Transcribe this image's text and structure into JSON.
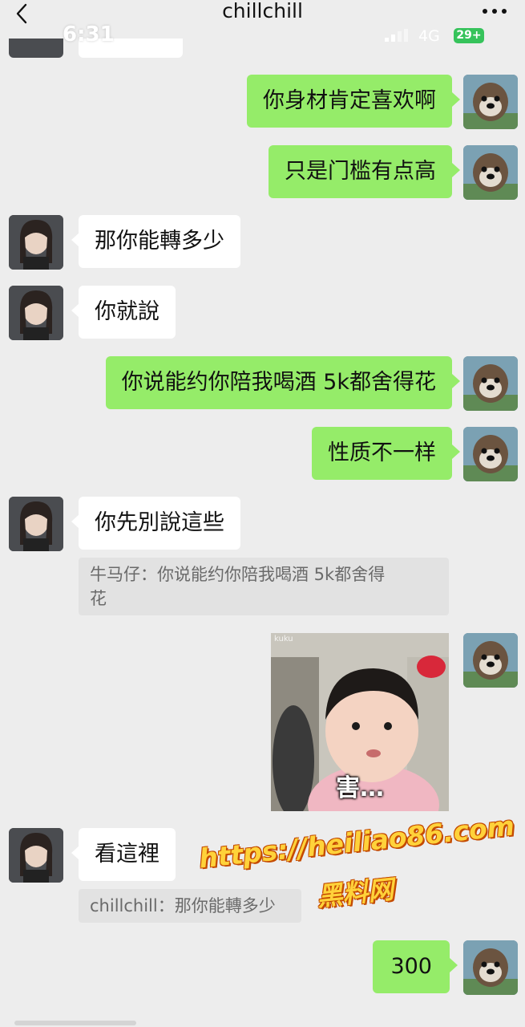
{
  "header": {
    "title": "chillchill",
    "back_icon": "chevron-left-icon",
    "more_icon": "more-dots-icon"
  },
  "status_bar": {
    "time": "6:31",
    "network": "4G",
    "battery": "29+"
  },
  "messages": [
    {
      "side": "out",
      "text": "你身材肯定喜欢啊"
    },
    {
      "side": "out",
      "text": "只是门槛有点高"
    },
    {
      "side": "in",
      "text": "那你能轉多少"
    },
    {
      "side": "in",
      "text": "你就說"
    },
    {
      "side": "out",
      "text": "你说能约你陪我喝酒  5k都舍得花"
    },
    {
      "side": "out",
      "text": "性质不一样"
    },
    {
      "side": "in",
      "text": "你先別說這些",
      "quote_line1": "牛马仔：你说能约你陪我喝酒  5k都舍得",
      "quote_line2": "花"
    },
    {
      "side": "out",
      "type": "sticker",
      "caption": "害…",
      "tag": "kuku"
    },
    {
      "side": "in",
      "text": "看這裡",
      "quote_line1": "chillchill：那你能轉多少"
    },
    {
      "side": "out",
      "text": "300"
    }
  ],
  "watermark": {
    "url": "https://heiliao86.com",
    "text": "黑料网"
  },
  "colors": {
    "background": "#ededed",
    "outgoing_bubble": "#95ec69",
    "incoming_bubble": "#ffffff",
    "quote_bg": "#e2e2e2"
  }
}
